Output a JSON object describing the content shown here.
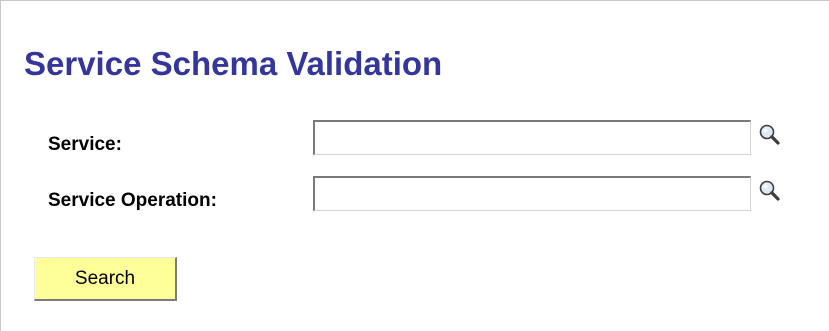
{
  "page": {
    "title": "Service Schema Validation"
  },
  "form": {
    "service": {
      "label": "Service:",
      "value": "",
      "lookup_icon": "search-icon"
    },
    "service_operation": {
      "label": "Service Operation:",
      "value": "",
      "lookup_icon": "search-icon"
    },
    "search_label": "Search"
  },
  "colors": {
    "title": "#35369c",
    "button_background": "#ffff99"
  }
}
